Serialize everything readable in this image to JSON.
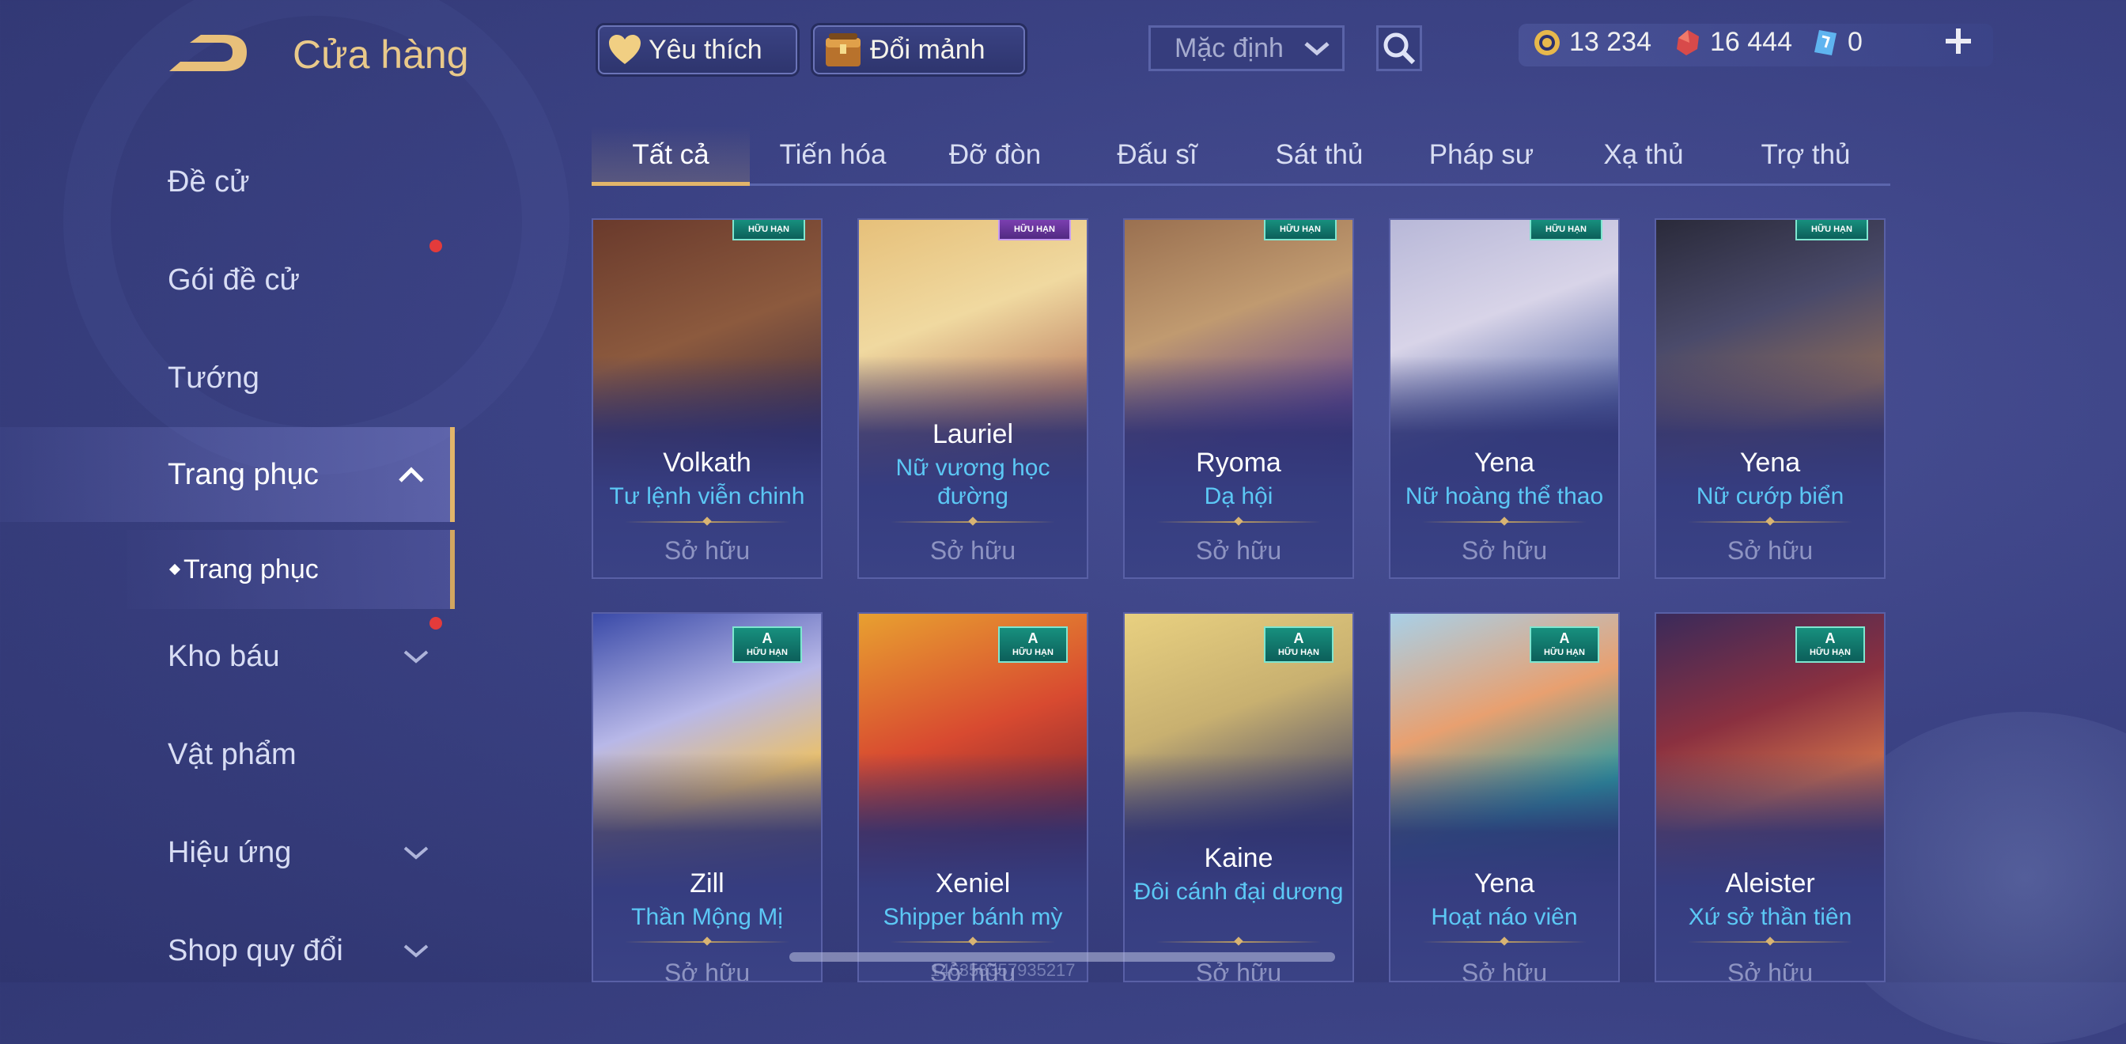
{
  "header": {
    "title": "Cửa hàng",
    "favorite_label": "Yêu thích",
    "exchange_label": "Đổi mảnh",
    "sort_value": "Mặc định"
  },
  "currency": {
    "gold": "13 234",
    "ruby": "16 444",
    "voucher": "0"
  },
  "sidebar": {
    "items": [
      {
        "label": "Đề cử"
      },
      {
        "label": "Gói đề cử"
      },
      {
        "label": "Tướng"
      },
      {
        "label": "Trang phục"
      },
      {
        "label": "Kho báu"
      },
      {
        "label": "Vật phẩm"
      },
      {
        "label": "Hiệu ứng"
      },
      {
        "label": "Shop quy đổi"
      }
    ],
    "sub_item": "Trang phục"
  },
  "tabs": [
    "Tất cả",
    "Tiến hóa",
    "Đỡ đòn",
    "Đấu sĩ",
    "Sát thủ",
    "Pháp sư",
    "Xạ thủ",
    "Trợ thủ"
  ],
  "cards": [
    {
      "hero": "Volkath",
      "skin": "Tư lệnh viễn chinh",
      "tag": "HỮU HẠN",
      "status": "Sở hữu"
    },
    {
      "hero": "Lauriel",
      "skin": "Nữ vương học đường",
      "tag": "HỮU HẠN",
      "status": "Sở hữu"
    },
    {
      "hero": "Ryoma",
      "skin": "Dạ hội",
      "tag": "HỮU HẠN",
      "status": "Sở hữu"
    },
    {
      "hero": "Yena",
      "skin": "Nữ hoàng thể thao",
      "tag": "HỮU HẠN",
      "status": "Sở hữu"
    },
    {
      "hero": "Yena",
      "skin": "Nữ cướp biển",
      "tag": "HỮU HẠN",
      "status": "Sở hữu"
    },
    {
      "hero": "Zill",
      "skin": "Thần Mộng Mị",
      "tag_grade": "A",
      "tag": "HỮU HẠN",
      "status": "Sở hữu"
    },
    {
      "hero": "Xeniel",
      "skin": "Shipper bánh mỳ",
      "tag_grade": "A",
      "tag": "HỮU HẠN",
      "status": "Sở hữu"
    },
    {
      "hero": "Kaine",
      "skin": "Đôi cánh đại dương",
      "tag_grade": "A",
      "tag": "HỮU HẠN",
      "status": "Sở hữu"
    },
    {
      "hero": "Yena",
      "skin": "Hoạt náo viên",
      "tag_grade": "A",
      "tag": "HỮU HẠN",
      "status": "Sở hữu"
    },
    {
      "hero": "Aleister",
      "skin": "Xứ sở thần tiên",
      "tag_grade": "A",
      "tag": "HỮU HẠN",
      "status": "Sở hữu"
    }
  ],
  "footer": {
    "uid": "146358357935217"
  },
  "colors": {
    "accent_gold": "#e2b56a",
    "skin_name": "#5cc8f5",
    "owned_text": "#8e94c2",
    "background": "#3b4284"
  }
}
